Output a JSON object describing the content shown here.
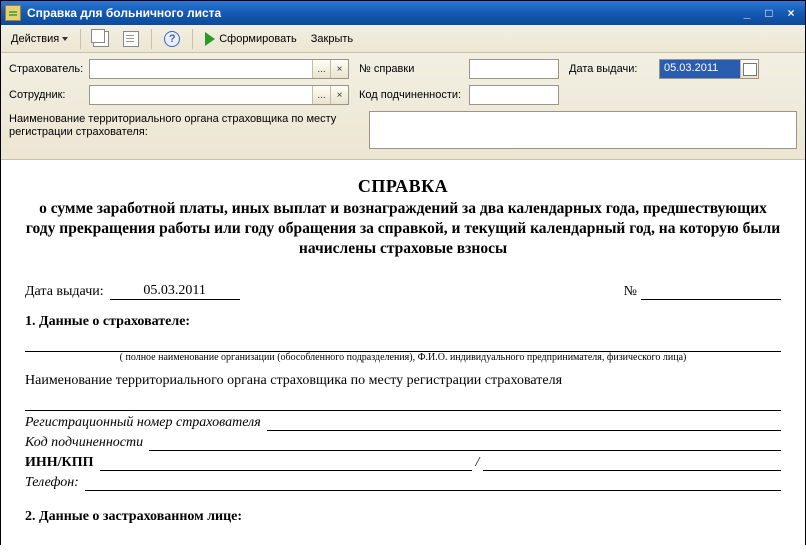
{
  "window": {
    "title": "Справка для больничного листа",
    "minimize": "_",
    "maximize": "□",
    "close": "×"
  },
  "toolbar": {
    "actions_label": "Действия",
    "help_char": "?",
    "form_label": "Сформировать",
    "close_label": "Закрыть"
  },
  "form": {
    "insurer_label": "Страхователь:",
    "insurer_value": "",
    "ellipsis": "...",
    "x": "×",
    "number_label": "№ справки",
    "number_value": "",
    "issue_date_label": "Дата выдачи:",
    "issue_date_value": "05.03.2011",
    "employee_label": "Сотрудник:",
    "employee_value": "",
    "code_label": "Код подчиненности:",
    "code_value": "",
    "territory_label": "Наименование территориального органа страховщика по месту регистрации страхователя:",
    "territory_value": ""
  },
  "document": {
    "title": "СПРАВКА",
    "subtitle": "о сумме заработной платы, иных выплат и вознаграждений за два календарных года, предшествующих году прекращения работы или году обращения за справкой, и текущий календарный год, на которую были начислены страховые взносы",
    "date_label": "Дата выдачи:",
    "date_value": "05.03.2011",
    "num_label": "№",
    "section1": "1. Данные о страхователе:",
    "hint1": "( полное наименование организации (обособленного подразделения), Ф.И.О.  индивидуального предпринимателя, физического лица)",
    "territory_full": "Наименование территориального органа страховщика по месту регистрации страхователя",
    "reg_number": "Регистрационный номер страхователя",
    "sub_code": "Код подчиненности",
    "inn_kpp": "ИНН/КПП",
    "slash": "/",
    "phone": "Телефон:",
    "section2": "2. Данные о застрахованном лице:"
  }
}
